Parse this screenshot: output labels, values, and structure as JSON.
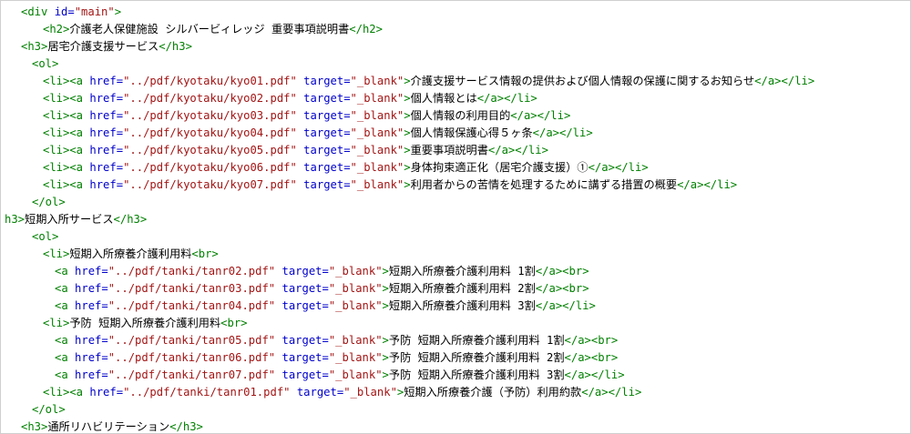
{
  "colors": {
    "tag": "#008000",
    "attribute": "#0000cc",
    "string": "#a31515",
    "text": "#000000",
    "border": "#cfcfcf"
  },
  "lines": [
    {
      "indent": 1,
      "tokens": [
        {
          "t": "tag",
          "v": "<div "
        },
        {
          "t": "attr",
          "v": "id="
        },
        {
          "t": "str",
          "v": "\"main\""
        },
        {
          "t": "tag",
          "v": ">"
        }
      ]
    },
    {
      "indent": 3,
      "tokens": [
        {
          "t": "tag",
          "v": "<h2>"
        },
        {
          "t": "txt",
          "v": "介護老人保健施設 シルバービィレッジ 重要事項説明書"
        },
        {
          "t": "tag",
          "v": "</h2>"
        }
      ]
    },
    {
      "indent": 1,
      "tokens": [
        {
          "t": "tag",
          "v": "<h3>"
        },
        {
          "t": "txt",
          "v": "居宅介護支援サービス"
        },
        {
          "t": "tag",
          "v": "</h3>"
        }
      ]
    },
    {
      "indent": 2,
      "tokens": [
        {
          "t": "tag",
          "v": "<ol>"
        }
      ]
    },
    {
      "indent": 3,
      "tokens": [
        {
          "t": "tag",
          "v": "<li><a "
        },
        {
          "t": "attr",
          "v": "href="
        },
        {
          "t": "str",
          "v": "\"../pdf/kyotaku/kyo01.pdf\""
        },
        {
          "t": "attr",
          "v": " target="
        },
        {
          "t": "str",
          "v": "\"_blank\""
        },
        {
          "t": "tag",
          "v": ">"
        },
        {
          "t": "txt",
          "v": "介護支援サービス情報の提供および個人情報の保護に関するお知らせ"
        },
        {
          "t": "tag",
          "v": "</a></li>"
        }
      ]
    },
    {
      "indent": 3,
      "tokens": [
        {
          "t": "tag",
          "v": "<li><a "
        },
        {
          "t": "attr",
          "v": "href="
        },
        {
          "t": "str",
          "v": "\"../pdf/kyotaku/kyo02.pdf\""
        },
        {
          "t": "attr",
          "v": " target="
        },
        {
          "t": "str",
          "v": "\"_blank\""
        },
        {
          "t": "tag",
          "v": ">"
        },
        {
          "t": "txt",
          "v": "個人情報とは"
        },
        {
          "t": "tag",
          "v": "</a></li>"
        }
      ]
    },
    {
      "indent": 3,
      "tokens": [
        {
          "t": "tag",
          "v": "<li><a "
        },
        {
          "t": "attr",
          "v": "href="
        },
        {
          "t": "str",
          "v": "\"../pdf/kyotaku/kyo03.pdf\""
        },
        {
          "t": "attr",
          "v": " target="
        },
        {
          "t": "str",
          "v": "\"_blank\""
        },
        {
          "t": "tag",
          "v": ">"
        },
        {
          "t": "txt",
          "v": "個人情報の利用目的"
        },
        {
          "t": "tag",
          "v": "</a></li>"
        }
      ]
    },
    {
      "indent": 3,
      "tokens": [
        {
          "t": "tag",
          "v": "<li><a "
        },
        {
          "t": "attr",
          "v": "href="
        },
        {
          "t": "str",
          "v": "\"../pdf/kyotaku/kyo04.pdf\""
        },
        {
          "t": "attr",
          "v": " target="
        },
        {
          "t": "str",
          "v": "\"_blank\""
        },
        {
          "t": "tag",
          "v": ">"
        },
        {
          "t": "txt",
          "v": "個人情報保護心得５ヶ条"
        },
        {
          "t": "tag",
          "v": "</a></li>"
        }
      ]
    },
    {
      "indent": 3,
      "tokens": [
        {
          "t": "tag",
          "v": "<li><a "
        },
        {
          "t": "attr",
          "v": "href="
        },
        {
          "t": "str",
          "v": "\"../pdf/kyotaku/kyo05.pdf\""
        },
        {
          "t": "attr",
          "v": " target="
        },
        {
          "t": "str",
          "v": "\"_blank\""
        },
        {
          "t": "tag",
          "v": ">"
        },
        {
          "t": "txt",
          "v": "重要事項説明書"
        },
        {
          "t": "tag",
          "v": "</a></li>"
        }
      ]
    },
    {
      "indent": 3,
      "tokens": [
        {
          "t": "tag",
          "v": "<li><a "
        },
        {
          "t": "attr",
          "v": "href="
        },
        {
          "t": "str",
          "v": "\"../pdf/kyotaku/kyo06.pdf\""
        },
        {
          "t": "attr",
          "v": " target="
        },
        {
          "t": "str",
          "v": "\"_blank\""
        },
        {
          "t": "tag",
          "v": ">"
        },
        {
          "t": "txt",
          "v": "身体拘束適正化（居宅介護支援）①"
        },
        {
          "t": "tag",
          "v": "</a></li>"
        }
      ]
    },
    {
      "indent": 3,
      "tokens": [
        {
          "t": "tag",
          "v": "<li><a "
        },
        {
          "t": "attr",
          "v": "href="
        },
        {
          "t": "str",
          "v": "\"../pdf/kyotaku/kyo07.pdf\""
        },
        {
          "t": "attr",
          "v": " target="
        },
        {
          "t": "str",
          "v": "\"_blank\""
        },
        {
          "t": "tag",
          "v": ">"
        },
        {
          "t": "txt",
          "v": "利用者からの苦情を処理するために講ずる措置の概要"
        },
        {
          "t": "tag",
          "v": "</a></li>"
        }
      ]
    },
    {
      "indent": 2,
      "tokens": [
        {
          "t": "tag",
          "v": "</ol>"
        }
      ]
    },
    {
      "indent": 0,
      "tokens": [
        {
          "t": "tag",
          "v": "h3>"
        },
        {
          "t": "txt",
          "v": "短期入所サービス"
        },
        {
          "t": "tag",
          "v": "</h3>"
        }
      ]
    },
    {
      "indent": 2,
      "tokens": [
        {
          "t": "tag",
          "v": "<ol>"
        }
      ]
    },
    {
      "indent": 3,
      "tokens": [
        {
          "t": "tag",
          "v": "<li>"
        },
        {
          "t": "txt",
          "v": "短期入所療養介護利用料"
        },
        {
          "t": "tag",
          "v": "<br>"
        }
      ]
    },
    {
      "indent": 4,
      "tokens": [
        {
          "t": "tag",
          "v": "<a "
        },
        {
          "t": "attr",
          "v": "href="
        },
        {
          "t": "str",
          "v": "\"../pdf/tanki/tanr02.pdf\""
        },
        {
          "t": "attr",
          "v": " target="
        },
        {
          "t": "str",
          "v": "\"_blank\""
        },
        {
          "t": "tag",
          "v": ">"
        },
        {
          "t": "txt",
          "v": "短期入所療養介護利用料 1割"
        },
        {
          "t": "tag",
          "v": "</a><br>"
        }
      ]
    },
    {
      "indent": 4,
      "tokens": [
        {
          "t": "tag",
          "v": "<a "
        },
        {
          "t": "attr",
          "v": "href="
        },
        {
          "t": "str",
          "v": "\"../pdf/tanki/tanr03.pdf\""
        },
        {
          "t": "attr",
          "v": " target="
        },
        {
          "t": "str",
          "v": "\"_blank\""
        },
        {
          "t": "tag",
          "v": ">"
        },
        {
          "t": "txt",
          "v": "短期入所療養介護利用料 2割"
        },
        {
          "t": "tag",
          "v": "</a><br>"
        }
      ]
    },
    {
      "indent": 4,
      "tokens": [
        {
          "t": "tag",
          "v": "<a "
        },
        {
          "t": "attr",
          "v": "href="
        },
        {
          "t": "str",
          "v": "\"../pdf/tanki/tanr04.pdf\""
        },
        {
          "t": "attr",
          "v": " target="
        },
        {
          "t": "str",
          "v": "\"_blank\""
        },
        {
          "t": "tag",
          "v": ">"
        },
        {
          "t": "txt",
          "v": "短期入所療養介護利用料 3割"
        },
        {
          "t": "tag",
          "v": "</a></li>"
        }
      ]
    },
    {
      "indent": 3,
      "tokens": [
        {
          "t": "tag",
          "v": "<li>"
        },
        {
          "t": "txt",
          "v": "予防 短期入所療養介護利用料"
        },
        {
          "t": "tag",
          "v": "<br>"
        }
      ]
    },
    {
      "indent": 4,
      "tokens": [
        {
          "t": "tag",
          "v": "<a "
        },
        {
          "t": "attr",
          "v": "href="
        },
        {
          "t": "str",
          "v": "\"../pdf/tanki/tanr05.pdf\""
        },
        {
          "t": "attr",
          "v": " target="
        },
        {
          "t": "str",
          "v": "\"_blank\""
        },
        {
          "t": "tag",
          "v": ">"
        },
        {
          "t": "txt",
          "v": "予防 短期入所療養介護利用料 1割"
        },
        {
          "t": "tag",
          "v": "</a><br>"
        }
      ]
    },
    {
      "indent": 4,
      "tokens": [
        {
          "t": "tag",
          "v": "<a "
        },
        {
          "t": "attr",
          "v": "href="
        },
        {
          "t": "str",
          "v": "\"../pdf/tanki/tanr06.pdf\""
        },
        {
          "t": "attr",
          "v": " target="
        },
        {
          "t": "str",
          "v": "\"_blank\""
        },
        {
          "t": "tag",
          "v": ">"
        },
        {
          "t": "txt",
          "v": "予防 短期入所療養介護利用料 2割"
        },
        {
          "t": "tag",
          "v": "</a><br>"
        }
      ]
    },
    {
      "indent": 4,
      "tokens": [
        {
          "t": "tag",
          "v": "<a "
        },
        {
          "t": "attr",
          "v": "href="
        },
        {
          "t": "str",
          "v": "\"../pdf/tanki/tanr07.pdf\""
        },
        {
          "t": "attr",
          "v": " target="
        },
        {
          "t": "str",
          "v": "\"_blank\""
        },
        {
          "t": "tag",
          "v": ">"
        },
        {
          "t": "txt",
          "v": "予防 短期入所療養介護利用料 3割"
        },
        {
          "t": "tag",
          "v": "</a></li>"
        }
      ]
    },
    {
      "indent": 3,
      "tokens": [
        {
          "t": "tag",
          "v": "<li><a "
        },
        {
          "t": "attr",
          "v": "href="
        },
        {
          "t": "str",
          "v": "\"../pdf/tanki/tanr01.pdf\""
        },
        {
          "t": "attr",
          "v": " target="
        },
        {
          "t": "str",
          "v": "\"_blank\""
        },
        {
          "t": "tag",
          "v": ">"
        },
        {
          "t": "txt",
          "v": "短期入所療養介護（予防）利用約款"
        },
        {
          "t": "tag",
          "v": "</a></li>"
        }
      ]
    },
    {
      "indent": 2,
      "tokens": [
        {
          "t": "tag",
          "v": "</ol>"
        }
      ]
    },
    {
      "indent": 1,
      "tokens": [
        {
          "t": "tag",
          "v": "<h3>"
        },
        {
          "t": "txt",
          "v": "通所リハビリテーション"
        },
        {
          "t": "tag",
          "v": "</h3>"
        }
      ]
    }
  ]
}
